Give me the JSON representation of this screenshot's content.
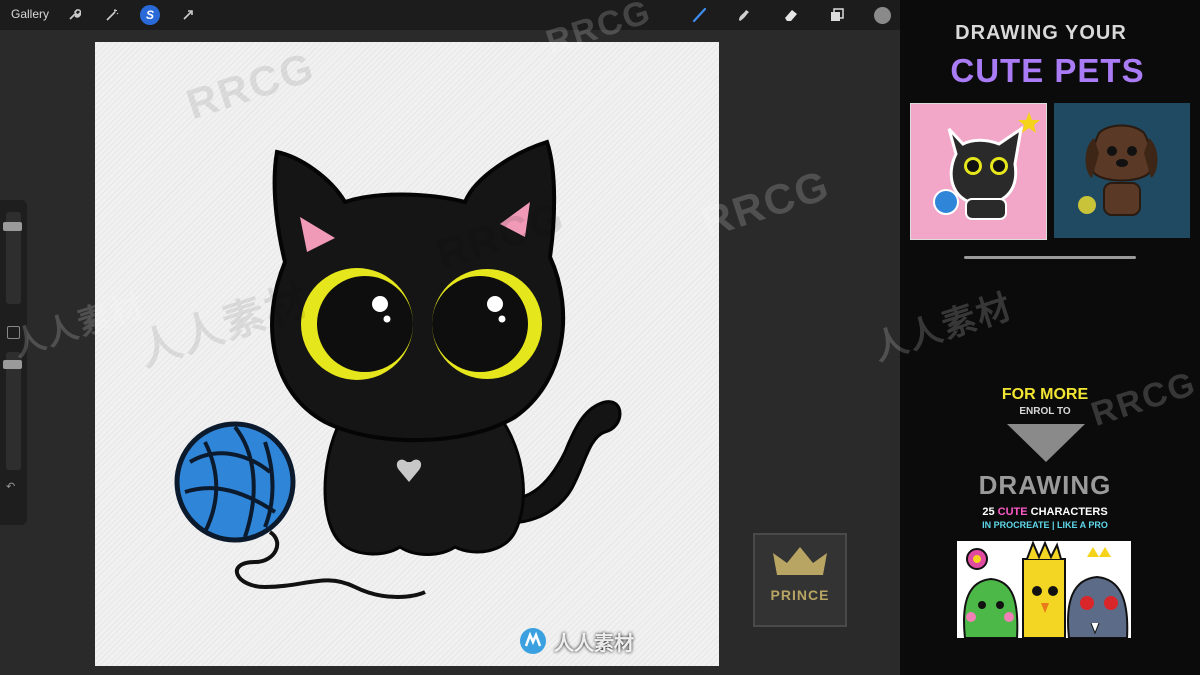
{
  "toolbar": {
    "gallery_label": "Gallery",
    "icons": [
      "wrench-icon",
      "magic-wand-icon",
      "selection-icon",
      "transform-icon",
      "brush-icon",
      "smudge-icon",
      "eraser-icon",
      "layers-icon",
      "color-picker"
    ],
    "selection_letter": "S",
    "active_color": "#8a8a8a"
  },
  "sidebar": {
    "icons": [
      "brush-size-slider",
      "modify-button",
      "opacity-slider",
      "undo-icon"
    ],
    "undo_glyph": "↶"
  },
  "canvas": {
    "subject": "black-cat-with-yarn",
    "colors": {
      "cat": "#141414",
      "eyes": "#e6e61c",
      "ears": "#f09ab8",
      "yarn": "#2f86d8",
      "heart": "#c8c8c8"
    }
  },
  "watermarks": {
    "rrcg": "RRCG",
    "cn": "人人素材",
    "prince": "PRINCE",
    "brand_text": "人人素材"
  },
  "promo": {
    "title_line1": "DRAWING YOUR",
    "title_line2": "CUTE PETS",
    "title_color": "#a97bf5",
    "for_more": "FOR MORE",
    "enrol": "ENROL TO",
    "drawing": "DRAWING",
    "chars_num": "25",
    "chars_cute": "CUTE",
    "chars_rest": "CHARACTERS",
    "in_procreate": "IN PROCREATE | LIKE A PRO"
  }
}
